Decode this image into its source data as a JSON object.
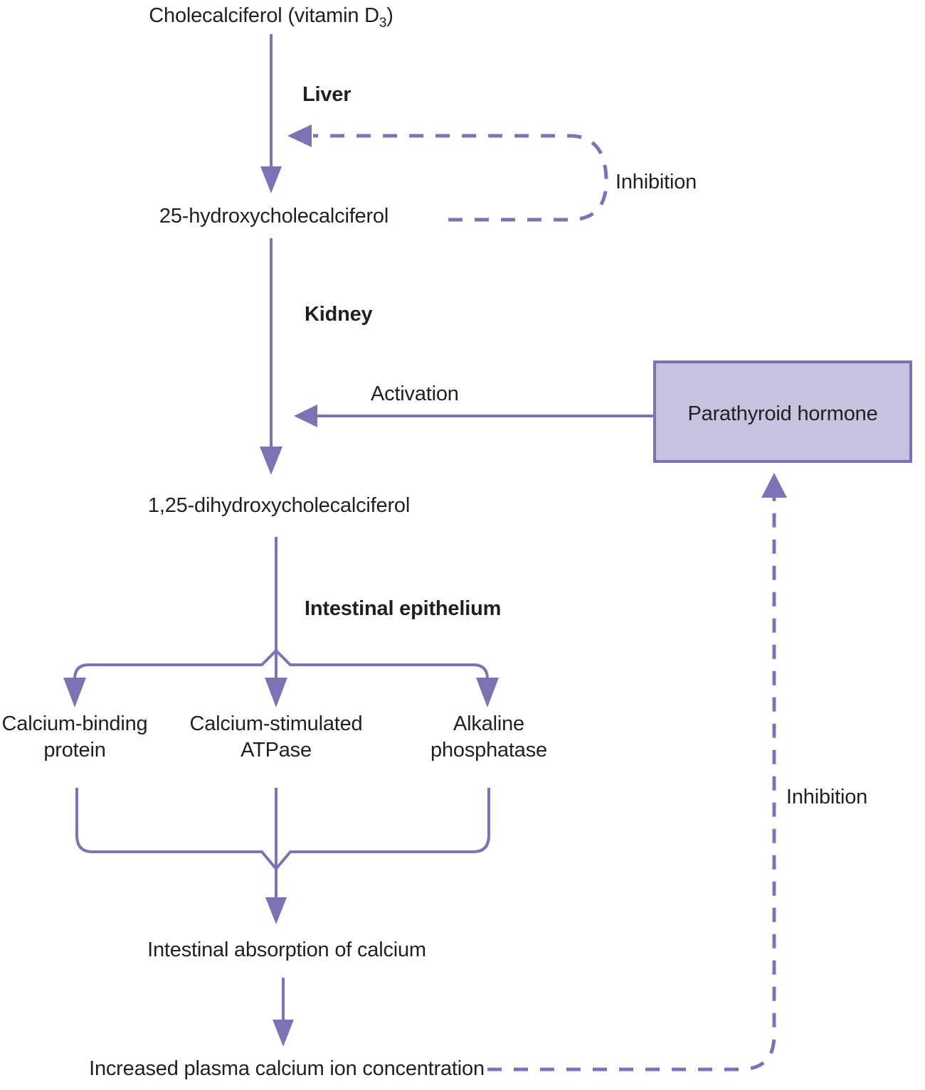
{
  "diagram": {
    "title": "Vitamin D metabolic activation and calcium absorption pathway",
    "colors": {
      "line": "#7b74b4",
      "box_fill": "#c6c2e0",
      "box_border": "#7b74b4",
      "text": "#231f20",
      "background": "#ffffff"
    },
    "nodes": {
      "cholecalciferol": {
        "text_pre": "Cholecalciferol (vitamin D",
        "text_sub": "3",
        "text_post": ")"
      },
      "hydroxycholecalciferol": {
        "label": "25-hydroxycholecalciferol"
      },
      "dihydroxycholecalciferol": {
        "label": "1,25-dihydroxycholecalciferol"
      },
      "calcium_binding_protein": {
        "line1": "Calcium-binding",
        "line2": "protein"
      },
      "calcium_stimulated_atpase": {
        "line1": "Calcium-stimulated",
        "line2": "ATPase"
      },
      "alkaline_phosphatase": {
        "line1": "Alkaline",
        "line2": "phosphatase"
      },
      "intestinal_absorption": {
        "label": "Intestinal absorption of calcium"
      },
      "increased_plasma_calcium": {
        "label": "Increased plasma calcium ion concentration"
      },
      "parathyroid_hormone": {
        "label": "Parathyroid hormone"
      }
    },
    "organ_labels": {
      "liver": "Liver",
      "kidney": "Kidney",
      "intestinal_epithelium": "Intestinal epithelium"
    },
    "edge_labels": {
      "inhibition_liver": "Inhibition",
      "activation_pth": "Activation",
      "inhibition_pth": "Inhibition"
    }
  }
}
